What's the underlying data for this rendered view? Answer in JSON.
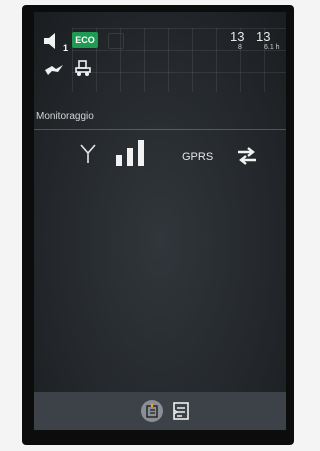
{
  "status": {
    "speaker_badge": "1",
    "eco_label": "ECO",
    "clock_primary": "13",
    "clock_primary_sub": "8",
    "clock_secondary": "13",
    "clock_secondary_sub": "6.1 h"
  },
  "section": {
    "title": "Monitoraggio"
  },
  "connection": {
    "gprs_label": "GPRS",
    "signal_level": 3,
    "signal_max": 3
  },
  "colors": {
    "eco_badge": "#1e9a52",
    "screen_bg": "#25292d",
    "bottom_bar": "#3c4248"
  },
  "icons": {
    "speaker": "speaker-icon",
    "bird": "bird-icon",
    "tractor": "tractor-icon",
    "antenna": "antenna-icon",
    "signal": "signal-strength-icon",
    "transfer": "transfer-arrows-icon",
    "doc_active": "document-active-icon",
    "doc_list": "document-list-icon"
  }
}
